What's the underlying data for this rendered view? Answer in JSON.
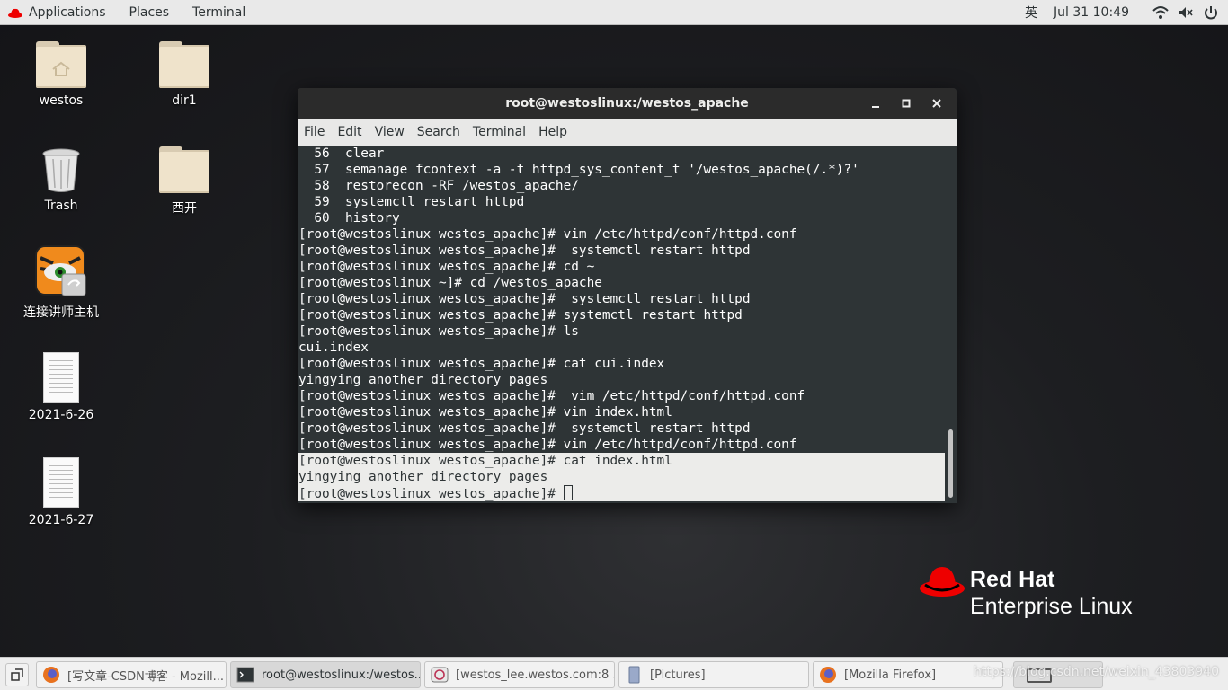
{
  "topbar": {
    "applications": "Applications",
    "places": "Places",
    "terminal": "Terminal",
    "input_method": "英",
    "clock": "Jul 31  10:49",
    "icons": [
      "wifi-icon",
      "volume-muted-icon",
      "power-icon"
    ]
  },
  "desktop": {
    "icons": [
      {
        "label": "westos",
        "type": "home-folder"
      },
      {
        "label": "dir1",
        "type": "folder"
      },
      {
        "label": "Trash",
        "type": "trash"
      },
      {
        "label": "西开",
        "type": "folder"
      },
      {
        "label": "连接讲师主机",
        "type": "app-shortcut"
      },
      {
        "label": "2021-6-26",
        "type": "document"
      },
      {
        "label": "2021-6-27",
        "type": "document"
      }
    ]
  },
  "window": {
    "title": "root@westoslinux:/westos_apache",
    "menu": [
      "File",
      "Edit",
      "View",
      "Search",
      "Terminal",
      "Help"
    ],
    "lines": [
      "  56  clear",
      "  57  semanage fcontext -a -t httpd_sys_content_t '/westos_apache(/.*)?'",
      "  58  restorecon -RF /westos_apache/",
      "  59  systemctl restart httpd",
      "  60  history",
      "[root@westoslinux westos_apache]# vim /etc/httpd/conf/httpd.conf",
      "[root@westoslinux westos_apache]#  systemctl restart httpd",
      "[root@westoslinux westos_apache]# cd ~",
      "[root@westoslinux ~]# cd /westos_apache",
      "[root@westoslinux westos_apache]#  systemctl restart httpd",
      "[root@westoslinux westos_apache]# systemctl restart httpd",
      "[root@westoslinux westos_apache]# ls",
      "cui.index",
      "[root@westoslinux westos_apache]# cat cui.index",
      "yingying another directory pages",
      "[root@westoslinux westos_apache]#  vim /etc/httpd/conf/httpd.conf",
      "[root@westoslinux westos_apache]# vim index.html",
      "[root@westoslinux westos_apache]#  systemctl restart httpd",
      "[root@westoslinux westos_apache]# vim /etc/httpd/conf/httpd.conf"
    ],
    "selected_lines": [
      "[root@westoslinux westos_apache]# cat index.html",
      "yingying another directory pages",
      "[root@westoslinux westos_apache]# "
    ]
  },
  "branding": {
    "name": "Red Hat",
    "product": "Enterprise Linux",
    "color": "#ee0000"
  },
  "taskbar": {
    "items": [
      {
        "label": "[写文章-CSDN博客 - Mozill...",
        "icon": "firefox-icon",
        "active": false
      },
      {
        "label": "root@westoslinux:/westos...",
        "icon": "terminal-icon",
        "active": true
      },
      {
        "label": "[westos_lee.westos.com:8 ...",
        "icon": "remote-viewer-icon",
        "active": false
      },
      {
        "label": "[Pictures]",
        "icon": "files-icon",
        "active": false
      },
      {
        "label": "[Mozilla Firefox]",
        "icon": "firefox-icon",
        "active": false
      }
    ],
    "watermark": "https://blog.csdn.net/weixin_43803940"
  }
}
